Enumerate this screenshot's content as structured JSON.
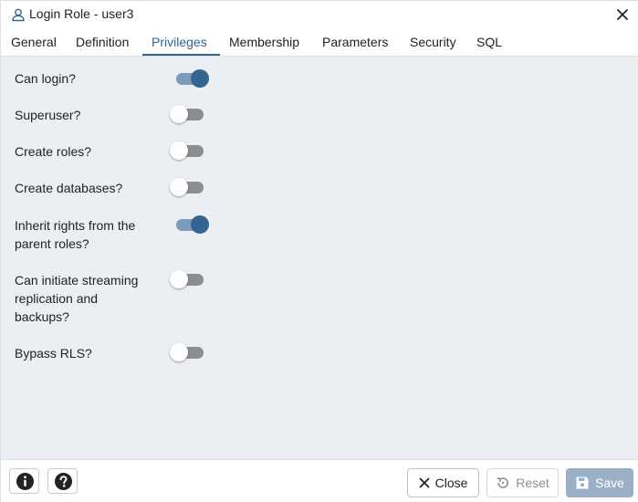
{
  "window": {
    "title": "Login Role - user3"
  },
  "tabs": [
    {
      "label": "General"
    },
    {
      "label": "Definition"
    },
    {
      "label": "Privileges",
      "active": true
    },
    {
      "label": "Membership"
    },
    {
      "label": "Parameters"
    },
    {
      "label": "Security"
    },
    {
      "label": "SQL"
    }
  ],
  "privileges": {
    "can_login": {
      "label": "Can login?",
      "value": true
    },
    "superuser": {
      "label": "Superuser?",
      "value": false
    },
    "create_roles": {
      "label": "Create roles?",
      "value": false
    },
    "create_databases": {
      "label": "Create databases?",
      "value": false
    },
    "inherit_rights": {
      "label": "Inherit rights from the parent roles?",
      "value": true
    },
    "replication": {
      "label": "Can initiate streaming replication and backups?",
      "value": false
    },
    "bypass_rls": {
      "label": "Bypass RLS?",
      "value": false
    }
  },
  "footer": {
    "close_label": "Close",
    "reset_label": "Reset",
    "save_label": "Save"
  },
  "icons": {
    "title": "user-icon",
    "close": "close-icon",
    "info": "info-icon",
    "help": "help-icon",
    "reset": "reset-icon",
    "save": "save-icon"
  },
  "colors": {
    "accent": "#326690",
    "switch_on_track": "#7c9bb6",
    "switch_off_track": "#8a8d92",
    "content_bg": "#ebeef3",
    "save_button": "#9bb0c6"
  }
}
